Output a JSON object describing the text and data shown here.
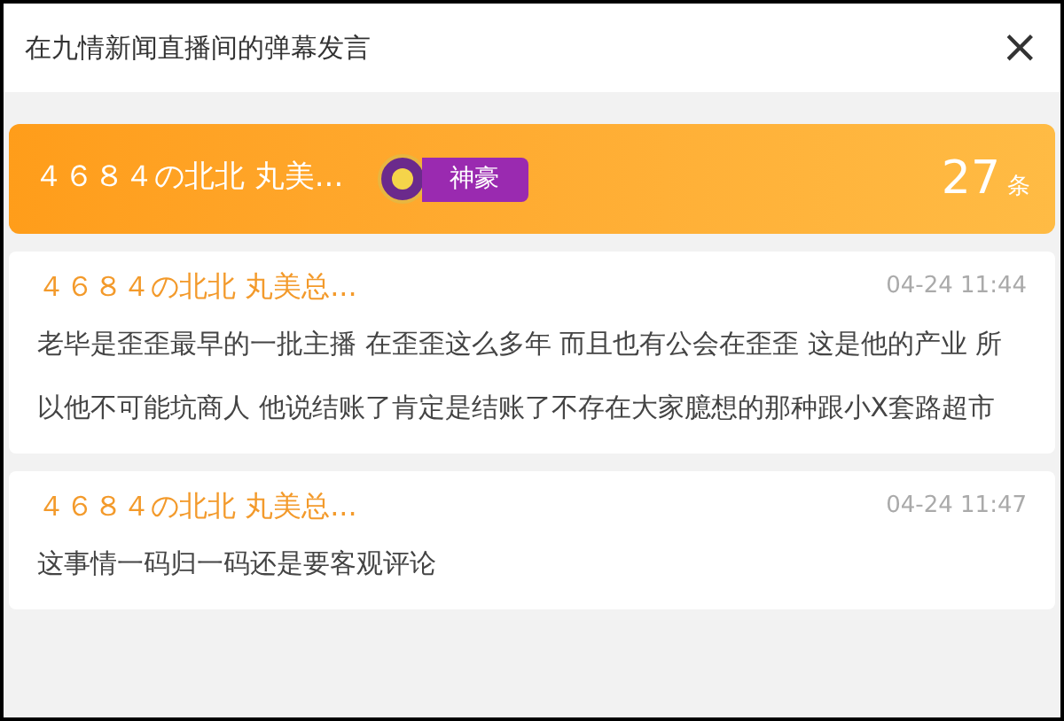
{
  "window": {
    "title": "在九情新闻直播间的弹幕发言",
    "close": "×"
  },
  "summary": {
    "user": "４６８４の北北 丸美...",
    "badge": "神豪",
    "count": "27",
    "unit": "条"
  },
  "comments": [
    {
      "user": "４６８４の北北 丸美总...",
      "time": "04-24 11:44",
      "text": "老毕是歪歪最早的一批主播 在歪歪这么多年 而且也有公会在歪歪 这是他的产业 所以他不可能坑商人 他说结账了肯定是结账了不存在大家臆想的那种跟小X套路超市"
    },
    {
      "user": "４６８４の北北 丸美总...",
      "time": "04-24 11:47",
      "text": "这事情一码归一码还是要客观评论"
    }
  ]
}
